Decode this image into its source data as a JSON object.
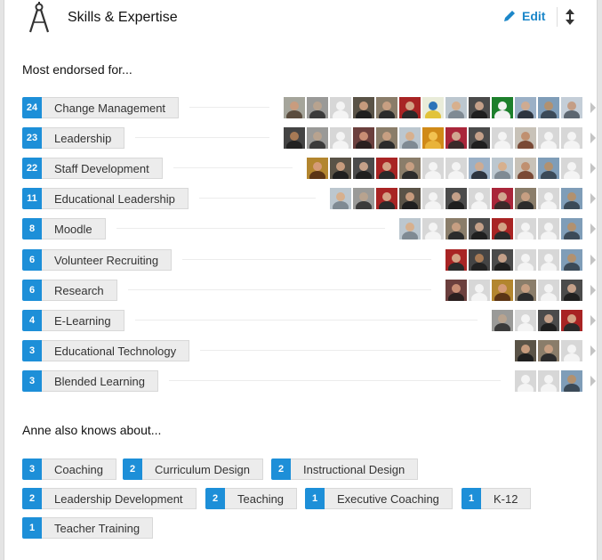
{
  "header": {
    "title": "Skills & Expertise",
    "edit_label": "Edit"
  },
  "most_endorsed_label": "Most endorsed for...",
  "also_knows_label": "Anne also knows about...",
  "colors": {
    "accent": "#1d8fd8",
    "link": "#1c87c9",
    "pill_bg": "#ececec"
  },
  "endorsed": [
    {
      "count": "24",
      "skill": "Change Management",
      "avatars": [
        "f1",
        "m2",
        "g",
        "m3",
        "m4",
        "m5",
        "x1",
        "f2",
        "m6",
        "grn",
        "m7",
        "m8",
        "m9"
      ]
    },
    {
      "count": "23",
      "skill": "Leadership",
      "avatars": [
        "f3",
        "m2",
        "g",
        "f4",
        "m4",
        "f2",
        "ylw",
        "f5",
        "m6",
        "g",
        "f6",
        "g",
        "g"
      ]
    },
    {
      "count": "22",
      "skill": "Staff Development",
      "avatars": [
        "f7",
        "m3",
        "m6",
        "m5",
        "m4",
        "g",
        "g",
        "m7",
        "f2",
        "f6",
        "m8",
        "g"
      ]
    },
    {
      "count": "11",
      "skill": "Educational Leadership",
      "avatars": [
        "f2",
        "m2",
        "m5",
        "m3",
        "g",
        "m6",
        "g",
        "f5",
        "m4",
        "g",
        "m8"
      ]
    },
    {
      "count": "8",
      "skill": "Moodle",
      "avatars": [
        "f2",
        "g",
        "m4",
        "m6",
        "m5",
        "g",
        "g",
        "m8"
      ]
    },
    {
      "count": "6",
      "skill": "Volunteer Recruiting",
      "avatars": [
        "m5",
        "f3",
        "m6",
        "g",
        "g",
        "m8"
      ]
    },
    {
      "count": "6",
      "skill": "Research",
      "avatars": [
        "f4",
        "g",
        "f7",
        "m4",
        "g",
        "m6"
      ]
    },
    {
      "count": "4",
      "skill": "E-Learning",
      "avatars": [
        "m2",
        "g",
        "m6",
        "m5"
      ]
    },
    {
      "count": "3",
      "skill": "Educational Technology",
      "avatars": [
        "m3",
        "m4",
        "g"
      ]
    },
    {
      "count": "3",
      "skill": "Blended Learning",
      "avatars": [
        "g",
        "g",
        "m8"
      ]
    }
  ],
  "also_knows": [
    {
      "count": "3",
      "skill": "Coaching"
    },
    {
      "count": "2",
      "skill": "Curriculum Design"
    },
    {
      "count": "2",
      "skill": "Instructional Design"
    },
    {
      "count": "2",
      "skill": "Leadership Development"
    },
    {
      "count": "2",
      "skill": "Teaching"
    },
    {
      "count": "1",
      "skill": "Executive Coaching"
    },
    {
      "count": "1",
      "skill": "K-12"
    },
    {
      "count": "1",
      "skill": "Teacher Training"
    }
  ]
}
